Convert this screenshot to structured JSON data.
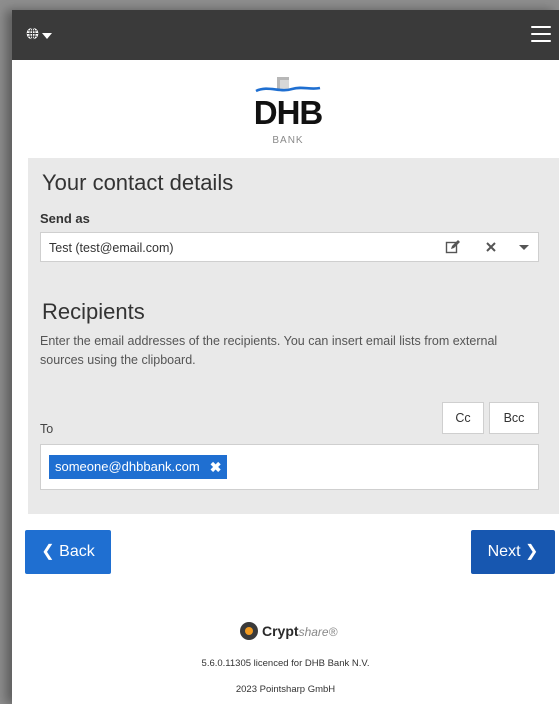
{
  "header": {
    "language_icon": "globe-icon",
    "menu_icon": "hamburger-menu-icon"
  },
  "logo": {
    "name": "DHB",
    "sub": "BANK"
  },
  "contact": {
    "title": "Your contact details",
    "send_as_label": "Send as",
    "sender_value": "Test (test@email.com)",
    "icons": [
      "edit-icon",
      "clear-icon",
      "dropdown-icon"
    ]
  },
  "recipients": {
    "title": "Recipients",
    "description": "Enter the email addresses of the recipients. You can insert email lists from external sources using the clipboard.",
    "cc_label": "Cc",
    "bcc_label": "Bcc",
    "to_label": "To",
    "to_values": [
      "someone@dhbbank.com"
    ]
  },
  "nav": {
    "back_label": "Back",
    "next_label": "Next"
  },
  "footer": {
    "brand_bold": "Crypt",
    "brand_light": "share",
    "brand_mark": "®",
    "license": "5.6.0.11305 licenced for DHB Bank N.V.",
    "copyright": "2023 Pointsharp GmbH"
  },
  "colors": {
    "accent": "#1f6fd1",
    "header_bg": "#3a3a3a",
    "panel_bg": "#e9e9e9"
  }
}
